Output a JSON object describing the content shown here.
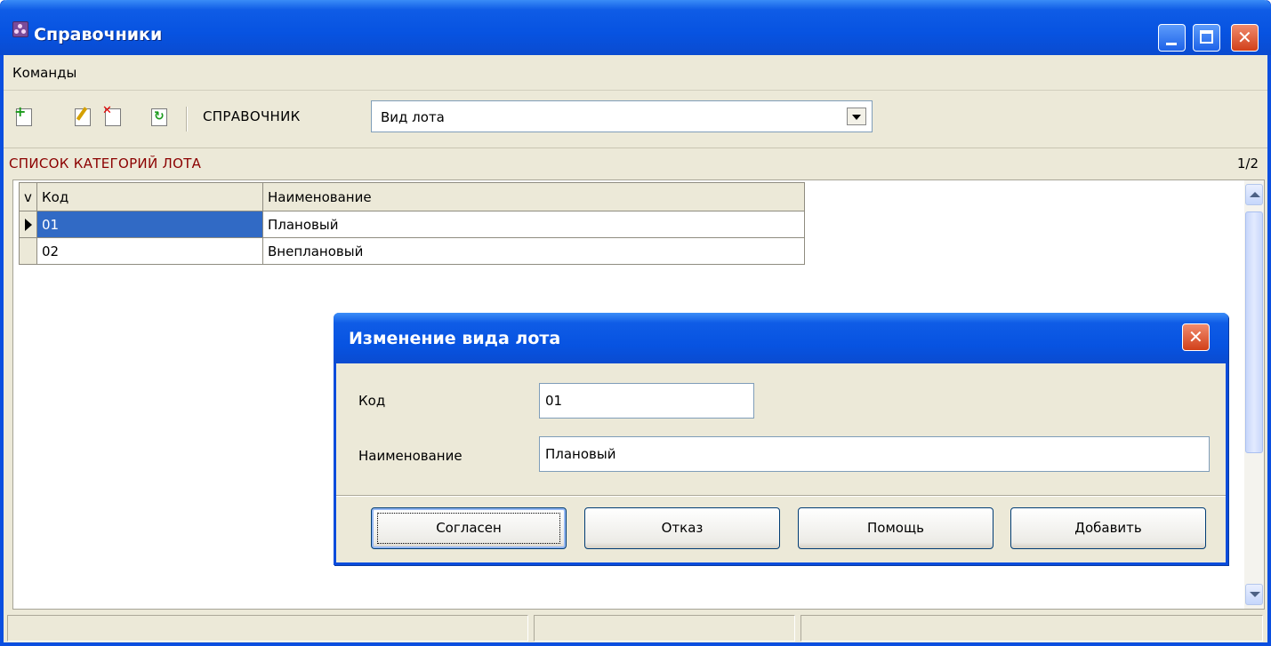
{
  "window": {
    "title": "Справочники",
    "menu": [
      "Команды"
    ]
  },
  "toolbar": {
    "icons": [
      "add-record-icon",
      "edit-record-icon",
      "delete-record-icon",
      "refresh-icon"
    ],
    "directory_label": "СПРАВОЧНИК",
    "directory_value": "Вид лота"
  },
  "section": {
    "title": "СПИСОК КАТЕГОРИЙ ЛОТА",
    "counter": "1/2"
  },
  "grid": {
    "indicator_header": "v",
    "columns": [
      "Код",
      "Наименование"
    ],
    "rows": [
      {
        "code": "01",
        "name": "Плановый",
        "selected": true
      },
      {
        "code": "02",
        "name": "Внеплановый",
        "selected": false
      }
    ]
  },
  "dialog": {
    "title": "Изменение вида лота",
    "code_label": "Код",
    "code_value": "01",
    "name_label": "Наименование",
    "name_value": "Плановый",
    "buttons": {
      "ok": "Согласен",
      "cancel": "Отказ",
      "help": "Помощь",
      "add": "Добавить"
    }
  },
  "colors": {
    "titlebar": "#0753e1",
    "section_title": "#8b0000",
    "selection": "#316ac5",
    "face": "#ece9d8"
  }
}
